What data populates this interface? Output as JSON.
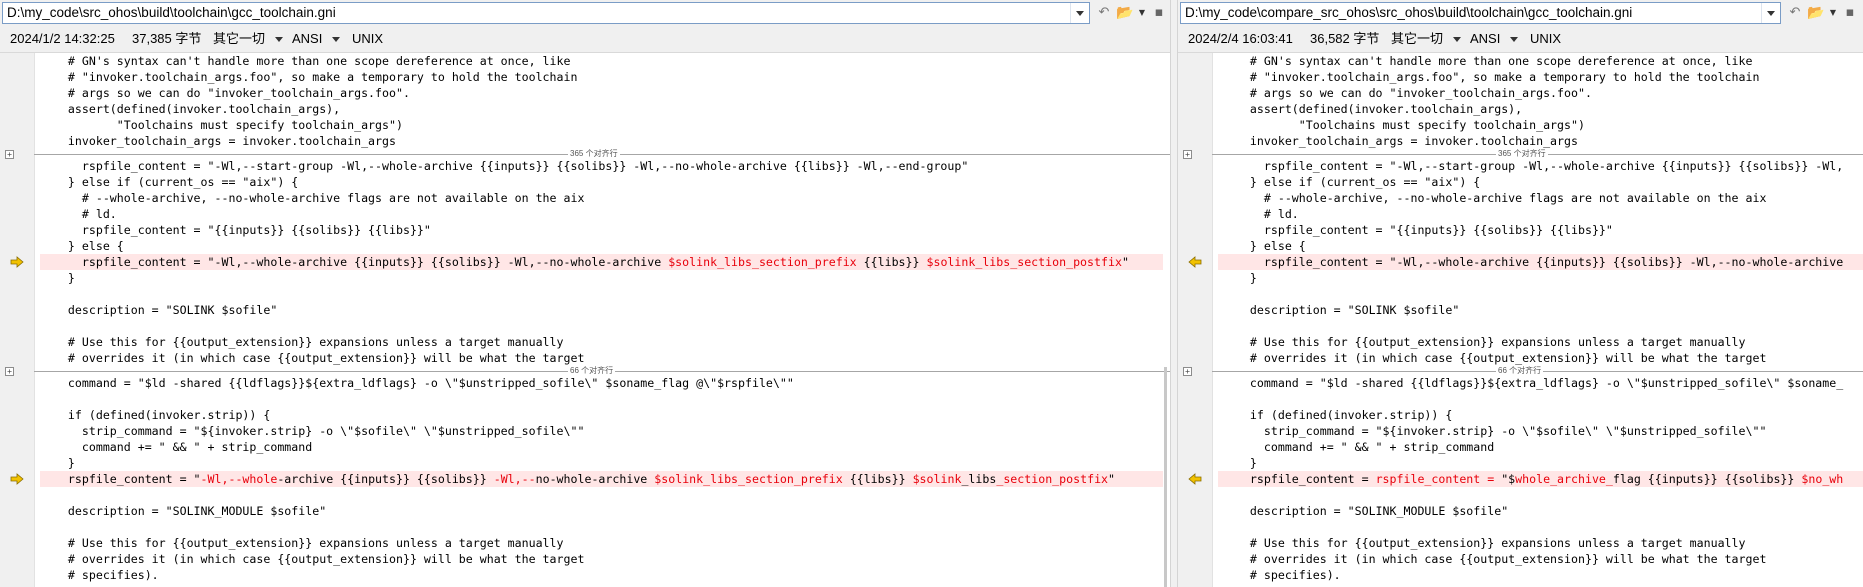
{
  "left": {
    "path": "D:\\my_code\\src_ohos\\build\\toolchain\\gcc_toolchain.gni",
    "info": {
      "datetime": "2024/1/2 14:32:25",
      "size": "37,385 字节",
      "filter": "其它一切",
      "encoding": "ANSI",
      "eol": "UNIX"
    },
    "block1": [
      "    # GN's syntax can't handle more than one scope dereference at once, like",
      "    # \"invoker.toolchain_args.foo\", so make a temporary to hold the toolchain",
      "    # args so we can do \"invoker_toolchain_args.foo\".",
      "    assert(defined(invoker.toolchain_args),",
      "           \"Toolchains must specify toolchain_args\")",
      "    invoker_toolchain_args = invoker.toolchain_args"
    ],
    "fold1_label": "365 个对齐行",
    "block2a": [
      "      rspfile_content = \"-Wl,--start-group -Wl,--whole-archive {{inputs}} {{solibs}} -Wl,--no-whole-archive {{libs}} -Wl,--end-group\"",
      "    } else if (current_os == \"aix\") {",
      "      # --whole-archive, --no-whole-archive flags are not available on the aix",
      "      # ld.",
      "      rspfile_content = \"{{inputs}} {{solibs}} {{libs}}\"",
      "    } else {"
    ],
    "diff1": {
      "a": "      rspfile_content = \"-Wl,--whole-archive {{inputs}} {{solibs}} -Wl,--no-whole-archive ",
      "b": "$solink_libs_section_prefix",
      "c": " {{libs}} ",
      "d": "$solink_libs_section_postfix",
      "e": "\""
    },
    "block2b": [
      "    }",
      "",
      "    description = \"SOLINK $sofile\"",
      "",
      "    # Use this for {{output_extension}} expansions unless a target manually",
      "    # overrides it (in which case {{output_extension}} will be what the target"
    ],
    "fold2_label": "66 个对齐行",
    "block3a": [
      "    command = \"$ld -shared {{ldflags}}${extra_ldflags} -o \\\"$unstripped_sofile\\\" $soname_flag @\\\"$rspfile\\\"\"",
      "",
      "    if (defined(invoker.strip)) {",
      "      strip_command = \"${invoker.strip} -o \\\"$sofile\\\" \\\"$unstripped_sofile\\\"\"",
      "      command += \" && \" + strip_command",
      "    }"
    ],
    "diff2": {
      "a": "    rspfile_content = \"",
      "b": "-Wl,--whole",
      "c": "-archive {{inputs}} {{solibs}} ",
      "d": "-Wl,--",
      "e": "no-whole-archive ",
      "f": "$solink_libs_section_prefix",
      "g": " {{libs}} ",
      "h": "$solink",
      "i": "_libs",
      "j": "_section_postfix",
      "k": "\""
    },
    "block3b": [
      "",
      "    description = \"SOLINK_MODULE $sofile\"",
      "",
      "    # Use this for {{output_extension}} expansions unless a target manually",
      "    # overrides it (in which case {{output_extension}} will be what the target",
      "    # specifies)."
    ]
  },
  "right": {
    "path": "D:\\my_code\\compare_src_ohos\\src_ohos\\build\\toolchain\\gcc_toolchain.gni",
    "info": {
      "datetime": "2024/2/4 16:03:41",
      "size": "36,582 字节",
      "filter": "其它一切",
      "encoding": "ANSI",
      "eol": "UNIX"
    },
    "block1": [
      "    # GN's syntax can't handle more than one scope dereference at once, like",
      "    # \"invoker.toolchain_args.foo\", so make a temporary to hold the toolchain",
      "    # args so we can do \"invoker_toolchain_args.foo\".",
      "    assert(defined(invoker.toolchain_args),",
      "           \"Toolchains must specify toolchain_args\")",
      "    invoker_toolchain_args = invoker.toolchain_args"
    ],
    "fold1_label": "365 个对齐行",
    "block2a": [
      "      rspfile_content = \"-Wl,--start-group -Wl,--whole-archive {{inputs}} {{solibs}} -Wl,",
      "    } else if (current_os == \"aix\") {",
      "      # --whole-archive, --no-whole-archive flags are not available on the aix",
      "      # ld.",
      "      rspfile_content = \"{{inputs}} {{solibs}} {{libs}}\"",
      "    } else {"
    ],
    "diff1": "      rspfile_content = \"-Wl,--whole-archive {{inputs}} {{solibs}} -Wl,--no-whole-archive",
    "block2b": [
      "    }",
      "",
      "    description = \"SOLINK $sofile\"",
      "",
      "    # Use this for {{output_extension}} expansions unless a target manually",
      "    # overrides it (in which case {{output_extension}} will be what the target"
    ],
    "fold2_label": "66 个对齐行",
    "block3a": [
      "    command = \"$ld -shared {{ldflags}}${extra_ldflags} -o \\\"$unstripped_sofile\\\" $soname_",
      "",
      "    if (defined(invoker.strip)) {",
      "      strip_command = \"${invoker.strip} -o \\\"$sofile\\\" \\\"$unstripped_sofile\\\"\"",
      "      command += \" && \" + strip_command",
      "    }"
    ],
    "diff2": {
      "a": "    rspfile_content = ",
      "b": "rspfile_content = ",
      "c": "\"$",
      "d": "whole_archive_",
      "e": "flag {{inputs}} {{solibs}} ",
      "f": "$no_wh"
    },
    "block3b": [
      "",
      "    description = \"SOLINK_MODULE $sofile\"",
      "",
      "    # Use this for {{output_extension}} expansions unless a target manually",
      "    # overrides it (in which case {{output_extension}} will be what the target",
      "    # specifies)."
    ]
  },
  "colors": {
    "diff_bg": "#ffe6e6",
    "diff_text": "#e8000b",
    "arrow": "#f2c200"
  },
  "icons": [
    "undo-icon",
    "folder-open-icon",
    "dropdown-arrow-icon",
    "save-icon",
    "next-diff-arrow-icon",
    "prev-diff-arrow-icon",
    "fold-expand-icon"
  ]
}
